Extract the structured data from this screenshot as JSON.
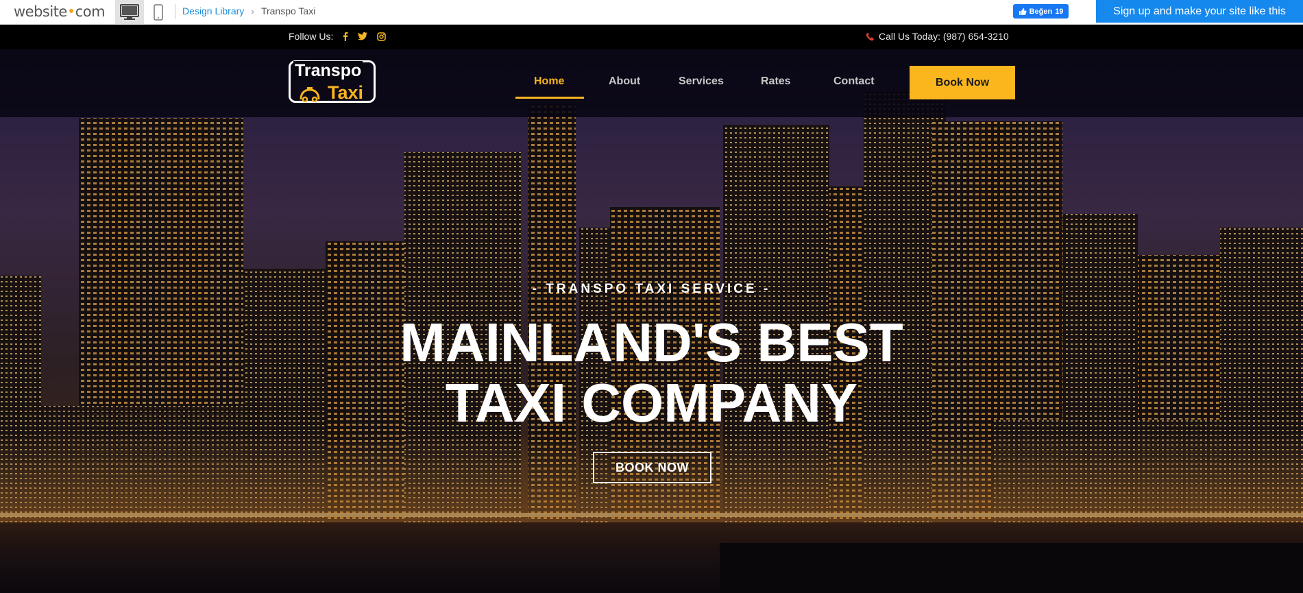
{
  "editor": {
    "brand_name": "website",
    "brand_dot": "•",
    "brand_tld": "com",
    "breadcrumb": [
      "Design Library",
      "Transpo Taxi"
    ],
    "fb_like_label": "Beğen",
    "fb_like_count": "19",
    "signup_label": "Sign up and make your site like this"
  },
  "infobar": {
    "follow_label": "Follow Us:",
    "social_icons": [
      "facebook-icon",
      "twitter-icon",
      "instagram-icon"
    ],
    "call_label": "Call Us Today: (987) 654-3210"
  },
  "logo": {
    "line1": "Transpo",
    "line2": "Taxi"
  },
  "nav": {
    "items": [
      {
        "label": "Home",
        "active": true
      },
      {
        "label": "About",
        "active": false
      },
      {
        "label": "Services",
        "active": false
      },
      {
        "label": "Rates",
        "active": false
      },
      {
        "label": "Contact",
        "active": false
      }
    ],
    "book_label": "Book Now"
  },
  "hero": {
    "subtitle": "- TRANSPO TAXI SERVICE -",
    "title_line1": "MAINLAND'S BEST",
    "title_line2": "TAXI COMPANY",
    "button_label": "BOOK NOW"
  },
  "colors": {
    "accent": "#fbb61e",
    "signup_blue": "#1589ee",
    "link_blue": "#1a8ed8",
    "facebook_blue": "#1877f2"
  }
}
